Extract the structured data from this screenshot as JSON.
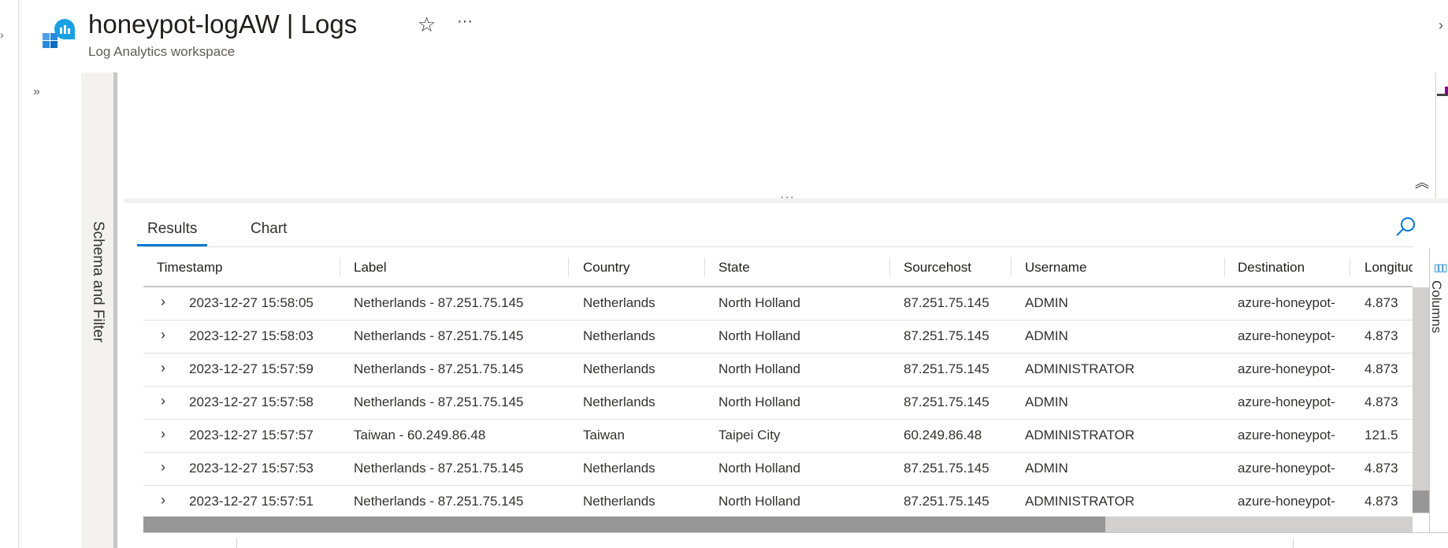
{
  "header": {
    "title": "honeypot-logAW | Logs",
    "subtitle": "Log Analytics workspace",
    "favorite_icon": "star-icon",
    "more_icon": "ellipsis-icon",
    "close_icon": "close-icon"
  },
  "schema_panel": {
    "label": "Schema and Filter"
  },
  "results": {
    "tabs": [
      {
        "label": "Results",
        "active": true
      },
      {
        "label": "Chart",
        "active": false
      }
    ],
    "columns_panel_label": "Columns",
    "accent_color": "#0078d4",
    "columns": [
      "Timestamp",
      "Label",
      "Country",
      "State",
      "Sourcehost",
      "Username",
      "Destination",
      "Longitude"
    ],
    "rows": [
      [
        "2023-12-27 15:58:05",
        "Netherlands - 87.251.75.145",
        "Netherlands",
        "North Holland",
        "87.251.75.145",
        "ADMIN",
        "azure-honeypot-",
        "4.873"
      ],
      [
        "2023-12-27 15:58:03",
        "Netherlands - 87.251.75.145",
        "Netherlands",
        "North Holland",
        "87.251.75.145",
        "ADMIN",
        "azure-honeypot-",
        "4.873"
      ],
      [
        "2023-12-27 15:57:59",
        "Netherlands - 87.251.75.145",
        "Netherlands",
        "North Holland",
        "87.251.75.145",
        "ADMINISTRATOR",
        "azure-honeypot-",
        "4.873"
      ],
      [
        "2023-12-27 15:57:58",
        "Netherlands - 87.251.75.145",
        "Netherlands",
        "North Holland",
        "87.251.75.145",
        "ADMIN",
        "azure-honeypot-",
        "4.873"
      ],
      [
        "2023-12-27 15:57:57",
        "Taiwan - 60.249.86.48",
        "Taiwan",
        "Taipei City",
        "60.249.86.48",
        "ADMINISTRATOR",
        "azure-honeypot-",
        "121.5"
      ],
      [
        "2023-12-27 15:57:53",
        "Netherlands - 87.251.75.145",
        "Netherlands",
        "North Holland",
        "87.251.75.145",
        "ADMIN",
        "azure-honeypot-",
        "4.873"
      ],
      [
        "2023-12-27 15:57:51",
        "Netherlands - 87.251.75.145",
        "Netherlands",
        "North Holland",
        "87.251.75.145",
        "ADMINISTRATOR",
        "azure-honeypot-",
        "4.873"
      ]
    ]
  }
}
